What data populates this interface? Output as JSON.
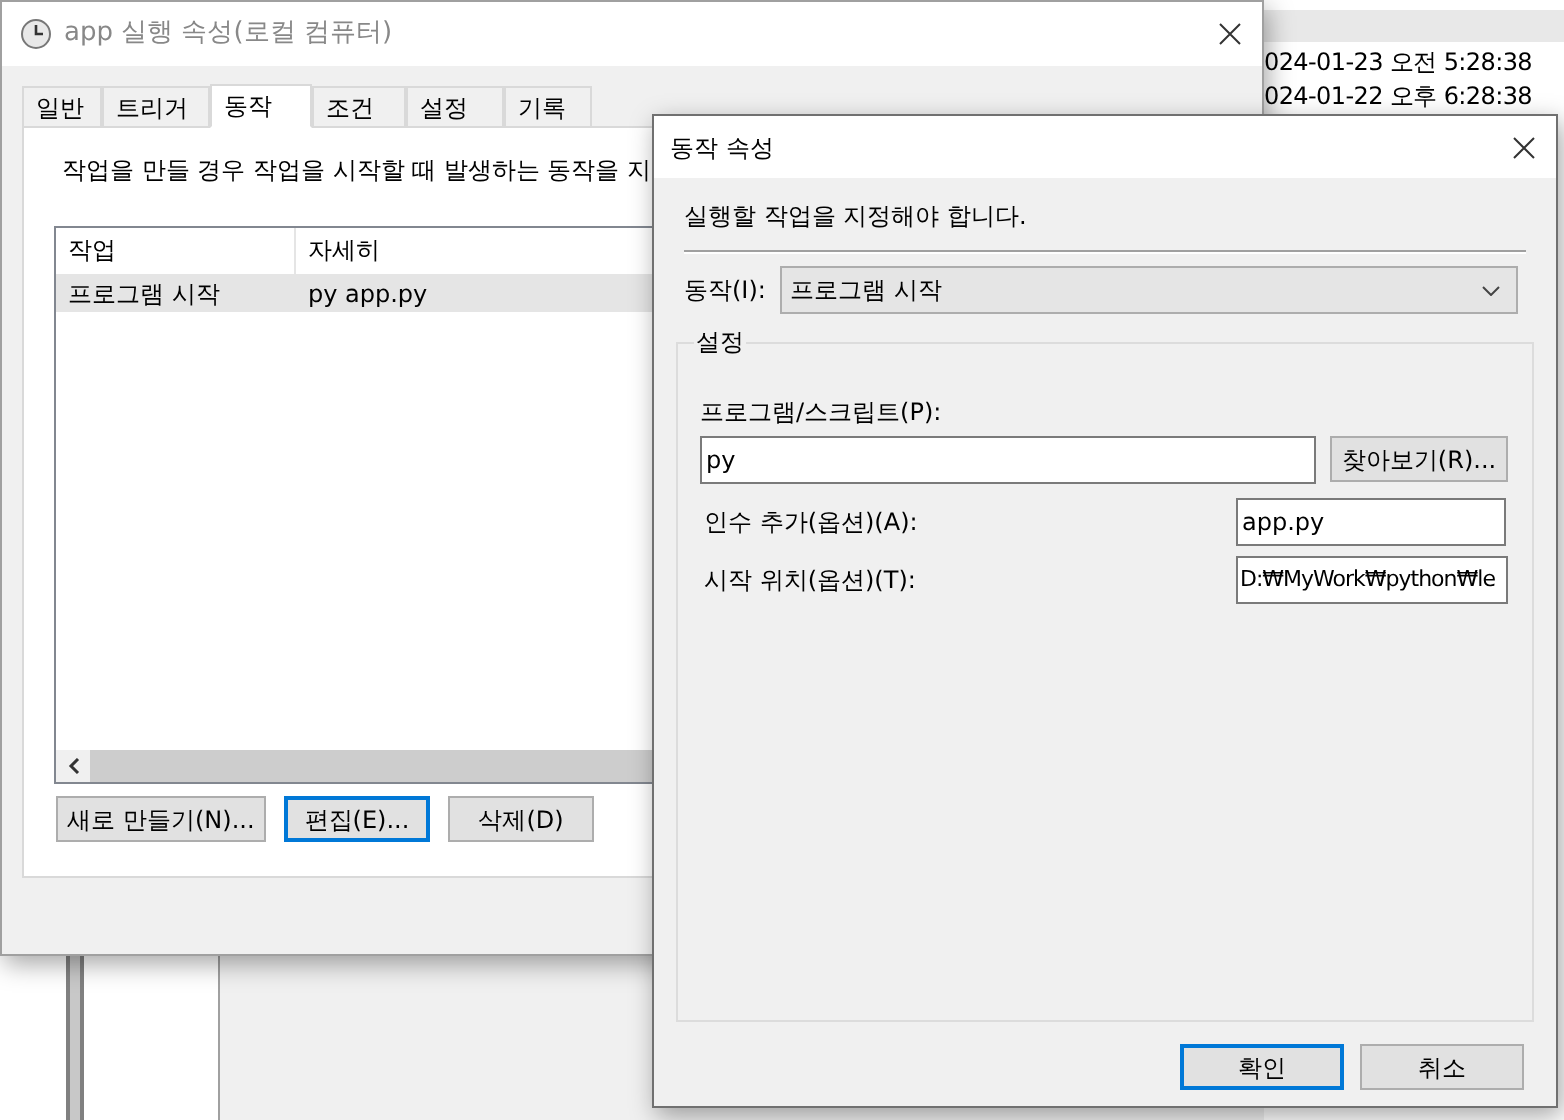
{
  "background_list": {
    "rows": [
      {
        "date": "024-01-23 오전 5:28:38"
      },
      {
        "date": "024-01-22 오후 6:28:38"
      }
    ]
  },
  "properties_window": {
    "title": "app 실행 속성(로컬 컴퓨터)",
    "tabs": [
      {
        "label": "일반",
        "selected": false
      },
      {
        "label": "트리거",
        "selected": false
      },
      {
        "label": "동작",
        "selected": true
      },
      {
        "label": "조건",
        "selected": false
      },
      {
        "label": "설정",
        "selected": false
      },
      {
        "label": "기록",
        "selected": false
      }
    ],
    "description": "작업을 만들 경우 작업을 시작할 때 발생하는 동작을 지",
    "table": {
      "columns": [
        "작업",
        "자세히"
      ],
      "rows": [
        {
          "cells": [
            "프로그램 시작",
            "py app.py"
          ],
          "selected": true
        }
      ]
    },
    "buttons": [
      {
        "label": "새로 만들기(N)...",
        "focused": false
      },
      {
        "label": "편집(E)...",
        "focused": true
      },
      {
        "label": "삭제(D)",
        "focused": false
      }
    ]
  },
  "action_dialog": {
    "title": "동작 속성",
    "instruction": "실행할 작업을 지정해야 합니다.",
    "action": {
      "label": "동작(I):",
      "value": "프로그램 시작"
    },
    "settings": {
      "title": "설정",
      "program_label": "프로그램/스크립트(P):",
      "program_value": "py",
      "browse_button": "찾아보기(R)...",
      "arguments_label": "인수 추가(옵션)(A):",
      "arguments_value": "app.py",
      "start_in_label": "시작 위치(옵션)(T):",
      "start_in_value": "D:₩MyWork₩python₩le"
    },
    "buttons": [
      {
        "label": "확인",
        "focused": true
      },
      {
        "label": "취소",
        "focused": false
      }
    ]
  }
}
